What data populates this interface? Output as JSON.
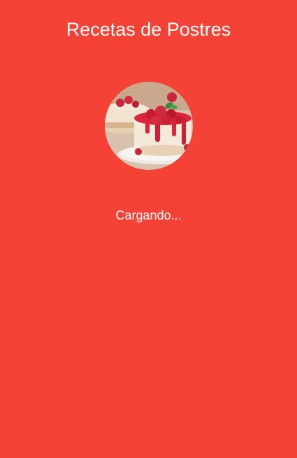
{
  "app": {
    "title": "Recetas de Postres"
  },
  "splash": {
    "image": "cheesecake-with-raspberries-image",
    "loading_text": "Cargando..."
  },
  "colors": {
    "background": "#F44336",
    "text": "#FFFFFF"
  }
}
